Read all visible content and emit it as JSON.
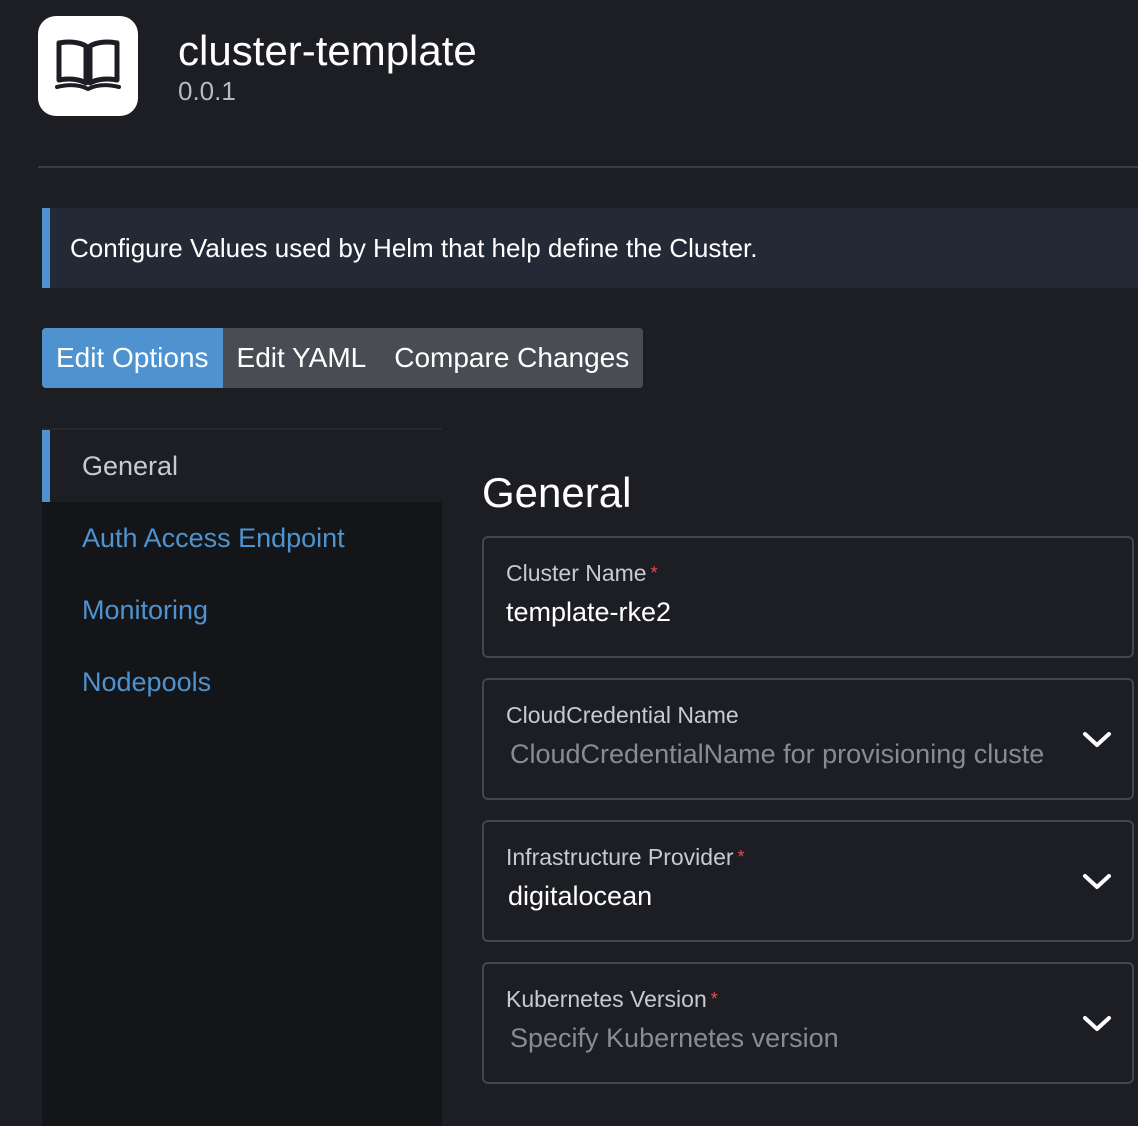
{
  "app": {
    "title": "cluster-template",
    "version": "0.0.1",
    "logo_icon": "book-icon"
  },
  "banner": {
    "text": "Configure Values used by Helm that help define the Cluster."
  },
  "tabs": [
    {
      "label": "Edit Options",
      "active": true
    },
    {
      "label": "Edit YAML",
      "active": false
    },
    {
      "label": "Compare Changes",
      "active": false
    }
  ],
  "sidenav": {
    "items": [
      {
        "label": "General",
        "active": true
      },
      {
        "label": "Auth Access Endpoint",
        "active": false
      },
      {
        "label": "Monitoring",
        "active": false
      },
      {
        "label": "Nodepools",
        "active": false
      }
    ]
  },
  "section": {
    "title": "General"
  },
  "fields": {
    "cluster_name": {
      "label": "Cluster Name",
      "required_mark": "*",
      "value": "template-rke2"
    },
    "cloud_credential": {
      "label": "CloudCredential Name",
      "placeholder": "CloudCredentialName for provisioning cluste"
    },
    "infra_provider": {
      "label": "Infrastructure Provider",
      "required_mark": "*",
      "value": "digitalocean"
    },
    "k8s_version": {
      "label": "Kubernetes Version",
      "required_mark": "*",
      "placeholder": "Specify Kubernetes version"
    }
  },
  "colors": {
    "accent": "#4e93cf",
    "required": "#e54b4b",
    "background": "#1c1e24",
    "sidebar": "#141519"
  }
}
